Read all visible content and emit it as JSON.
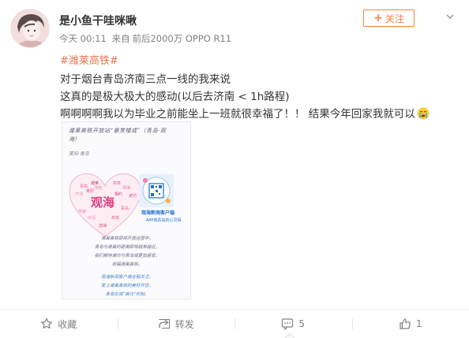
{
  "post": {
    "username": "是小鱼干哇咪啾",
    "time": "今天 00:11",
    "source_prefix": "来自",
    "source": "前后2000万 OPPO R11",
    "follow_label": "关注",
    "topic": "#潍莱高铁#",
    "text_line1": "对于烟台青岛济南三点一线的我来说",
    "text_line2": "这真的是极大极大的感动(以后去济南 < 1h路程)",
    "text_line3": "啊啊啊啊我以为毕业之前能坐上一班就很幸福了！！ 结果今年回家我就可以",
    "emoji_icon": "crying-face-emoji"
  },
  "poster": {
    "title_line1": "潍莱高铁开放站“悬赏楼成”（青岛·观",
    "title_line2": "海）",
    "small_text": "莱阳·青岛",
    "heart_word": "观海",
    "qr_caption": "观海新闻客户端",
    "qr_subcaption": "APP观青岛的心灵相",
    "verse": [
      "潍莱高铁即将开放运营中，",
      "青岛与潍莱的距离即将越来越近，",
      "我们期待潍坊与青岛城更加紧密，",
      "祝福潍莱高铁。"
    ],
    "verse_blue": [
      "观海新闻客户端全程关注，",
      "爱上潍莱高铁的美好开往，",
      "青岛在城“高光”时刻。"
    ]
  },
  "actions": {
    "favorite_label": "收藏",
    "repost_label": "转发",
    "comment_count": "5",
    "like_count": "1"
  },
  "colors": {
    "accent_orange": "#ff8140",
    "topic_color": "#eb7350",
    "meta_gray": "#808080",
    "heart_pink": "#e85a8f"
  }
}
